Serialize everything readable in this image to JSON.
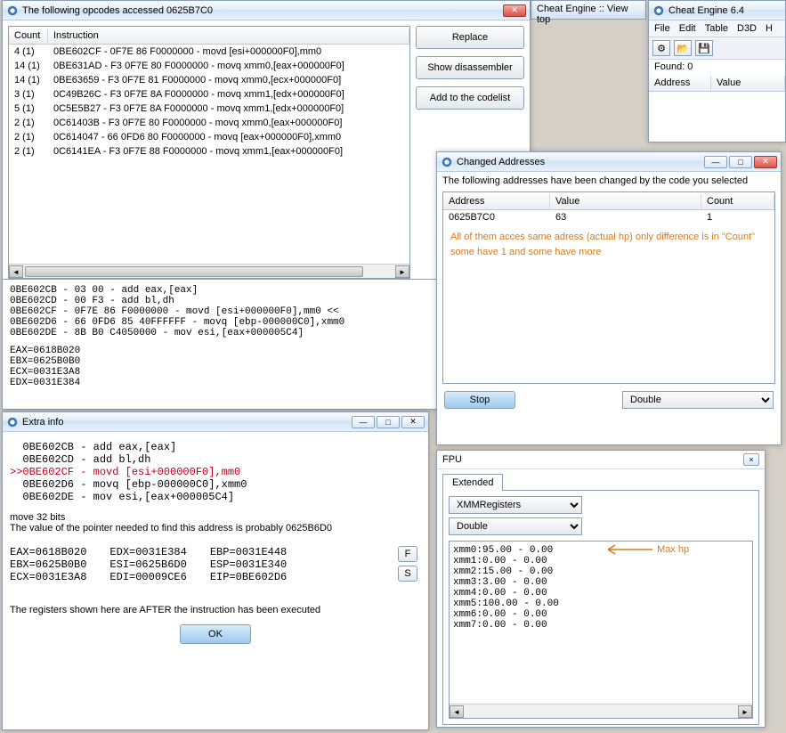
{
  "opcodes_window": {
    "title": "The following opcodes accessed 0625B7C0",
    "columns": [
      "Count",
      "Instruction"
    ],
    "rows": [
      {
        "count": "4 (1)",
        "instr": "0BE602CF - 0F7E 86 F0000000  - movd [esi+000000F0],mm0"
      },
      {
        "count": "14 (1)",
        "instr": "0BE631AD - F3 0F7E 80 F0000000  - movq xmm0,[eax+000000F0]"
      },
      {
        "count": "14 (1)",
        "instr": "0BE63659 - F3 0F7E 81 F0000000  - movq xmm0,[ecx+000000F0]"
      },
      {
        "count": "3 (1)",
        "instr": "0C49B26C - F3 0F7E 8A F0000000  - movq xmm1,[edx+000000F0]"
      },
      {
        "count": "5 (1)",
        "instr": "0C5E5B27 - F3 0F7E 8A F0000000  - movq xmm1,[edx+000000F0]"
      },
      {
        "count": "2 (1)",
        "instr": "0C61403B - F3 0F7E 80 F0000000  - movq xmm0,[eax+000000F0]"
      },
      {
        "count": "2 (1)",
        "instr": "0C614047 - 66 0FD6 80 F0000000  - movq [eax+000000F0],xmm0"
      },
      {
        "count": "2 (1)",
        "instr": "0C6141EA - F3 0F7E 88 F0000000  - movq xmm1,[eax+000000F0]"
      }
    ],
    "buttons": {
      "replace": "Replace",
      "show_disassembler": "Show disassembler",
      "add_to_codelist": "Add to the codelist"
    },
    "disasm": [
      "0BE602CB - 03 00  - add eax,[eax]",
      "0BE602CD - 00 F3  - add bl,dh",
      "0BE602CF - 0F7E 86 F0000000  - movd [esi+000000F0],mm0 <<",
      "0BE602D6 - 66 0FD6 85 40FFFFFF  - movq [ebp-000000C0],xmm0",
      "0BE602DE - 8B B0 C4050000  - mov esi,[eax+000005C4]"
    ],
    "regs": [
      "EAX=0618B020",
      "EBX=0625B0B0",
      "ECX=0031E3A8",
      "EDX=0031E384"
    ]
  },
  "extra_info": {
    "title": "Extra info",
    "lines": [
      {
        "text": "  0BE602CB - add eax,[eax]",
        "hl": false
      },
      {
        "text": "  0BE602CD - add bl,dh",
        "hl": false
      },
      {
        "text": ">>0BE602CF - movd [esi+000000F0],mm0",
        "hl": true
      },
      {
        "text": "  0BE602D6 - movq [ebp-000000C0],xmm0",
        "hl": false
      },
      {
        "text": "  0BE602DE - mov esi,[eax+000005C4]",
        "hl": false
      }
    ],
    "note1": "move 32 bits",
    "note2": "The value of the pointer needed to find this address is probably 0625B6D0",
    "reg_cols": [
      [
        "EAX=0618B020",
        "EBX=0625B0B0",
        "ECX=0031E3A8"
      ],
      [
        "EDX=0031E384",
        "ESI=0625B6D0",
        "EDI=00009CE6"
      ],
      [
        "EBP=0031E448",
        "ESP=0031E340",
        "EIP=0BE602D6"
      ]
    ],
    "side_btns": [
      "F",
      "S"
    ],
    "footer": "The registers shown here are AFTER the instruction has been executed",
    "ok": "OK"
  },
  "changed": {
    "title": "Changed Addresses",
    "desc": "The following addresses have been changed by the code you selected",
    "cols": [
      "Address",
      "Value",
      "Count"
    ],
    "row": {
      "addr": "0625B7C0",
      "val": "63",
      "count": "1"
    },
    "note": "All of them acces same adress (actual hp) only difference is in \"Count\" some have 1 and some have more",
    "stop": "Stop",
    "type": "Double"
  },
  "main_ce": {
    "title": "Cheat Engine 6.4",
    "menu": [
      "File",
      "Edit",
      "Table",
      "D3D",
      "H"
    ],
    "found": "Found: 0",
    "cols": [
      "Address",
      "Value"
    ]
  },
  "bg_tab": {
    "text": "Cheat Engine :: View top"
  },
  "fpu": {
    "title": "FPU",
    "tab": "Extended",
    "sel1": "XMMRegisters",
    "sel2": "Double",
    "lines": [
      "xmm0:95.00 - 0.00",
      "xmm1:0.00 - 0.00",
      "xmm2:15.00 - 0.00",
      "xmm3:3.00 - 0.00",
      "xmm4:0.00 - 0.00",
      "xmm5:100.00 - 0.00",
      "xmm6:0.00 - 0.00",
      "xmm7:0.00 - 0.00"
    ],
    "annot": "Max hp"
  }
}
